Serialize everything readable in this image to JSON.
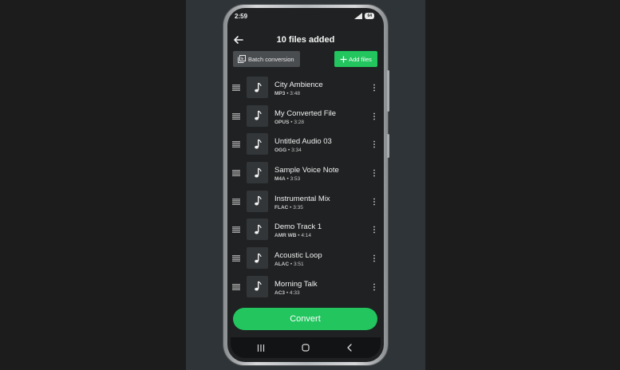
{
  "status_bar": {
    "time": "2:59",
    "battery": "64"
  },
  "header": {
    "title": "10 files added"
  },
  "toolbar": {
    "batch_label": "Batch conversion",
    "add_files_label": "Add files"
  },
  "files": [
    {
      "name": "City Ambience",
      "format": "MP3",
      "duration": "3:48"
    },
    {
      "name": "My Converted File",
      "format": "OPUS",
      "duration": "3:28"
    },
    {
      "name": "Untitled Audio 03",
      "format": "OGG",
      "duration": "3:34"
    },
    {
      "name": "Sample Voice Note",
      "format": "M4A",
      "duration": "3:53"
    },
    {
      "name": "Instrumental Mix",
      "format": "FLAC",
      "duration": "3:35"
    },
    {
      "name": "Demo Track 1",
      "format": "AMR WB",
      "duration": "4:14"
    },
    {
      "name": "Acoustic Loop",
      "format": "ALAC",
      "duration": "3:51"
    },
    {
      "name": "Morning Talk",
      "format": "AC3",
      "duration": "4:33"
    }
  ],
  "meta_separator": "•",
  "convert_label": "Convert",
  "icons": {
    "back": "back-arrow-icon",
    "batch": "batch-icon",
    "add": "plus-icon",
    "drag": "drag-handle-icon",
    "file": "music-note-icon",
    "more": "more-vert-icon",
    "nav_recents": "recents-icon",
    "nav_home": "home-icon",
    "nav_back": "nav-back-icon"
  },
  "colors": {
    "accent": "#22c55e",
    "screen_bg": "#1f2122",
    "thumb_bg": "#333638",
    "batch_bg": "#4a4d50",
    "text_primary": "#f0f0f0",
    "text_secondary": "#c8c8c8"
  }
}
